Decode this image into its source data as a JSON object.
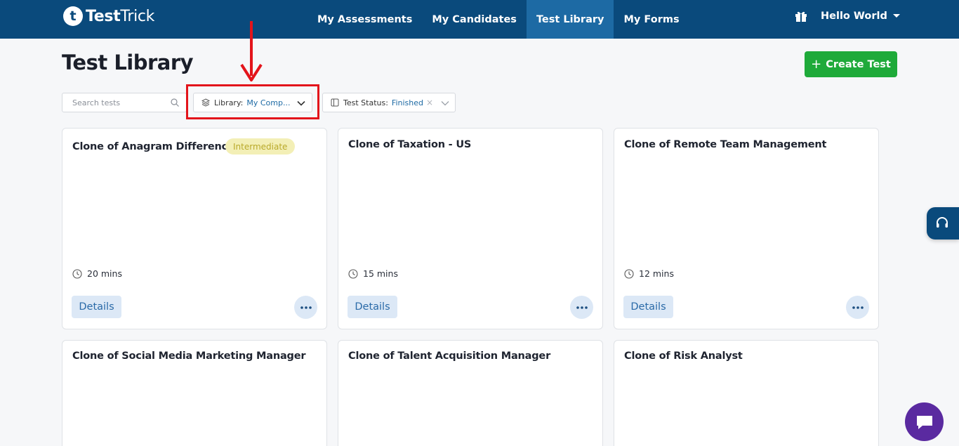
{
  "brand": {
    "mark": "t",
    "name_bold": "Test",
    "name_light": "Trick"
  },
  "nav": {
    "links": [
      {
        "label": "My Assessments",
        "active": false
      },
      {
        "label": "My Candidates",
        "active": false
      },
      {
        "label": "Test Library",
        "active": true
      },
      {
        "label": "My Forms",
        "active": false
      }
    ],
    "user_label": "Hello World"
  },
  "page": {
    "title": "Test Library",
    "create_button": {
      "icon": "+",
      "label": "Create Test"
    }
  },
  "search": {
    "placeholder": "Search tests",
    "value": ""
  },
  "filters": {
    "library": {
      "label": "Library:",
      "value": "My Comp..."
    },
    "status": {
      "label": "Test Status:",
      "value": "Finished",
      "clear": "×"
    }
  },
  "cards": [
    {
      "title": "Clone of Anagram Difference",
      "badge": "Intermediate",
      "duration": "20 mins",
      "details_label": "Details"
    },
    {
      "title": "Clone of Taxation - US",
      "duration": "15 mins",
      "details_label": "Details"
    },
    {
      "title": "Clone of Remote Team Management",
      "duration": "12 mins",
      "details_label": "Details"
    },
    {
      "title": "Clone of Social Media Marketing Manager"
    },
    {
      "title": "Clone of Talent Acquisition Manager"
    },
    {
      "title": "Clone of Risk Analyst"
    }
  ],
  "colors": {
    "nav_bg": "#0a4a7c",
    "nav_active": "#1d6aa4",
    "create_green": "#1faa3a",
    "badge_bg": "#f3efb6",
    "highlight_red": "#e3141b",
    "chat_purple": "#5a2aa0"
  }
}
